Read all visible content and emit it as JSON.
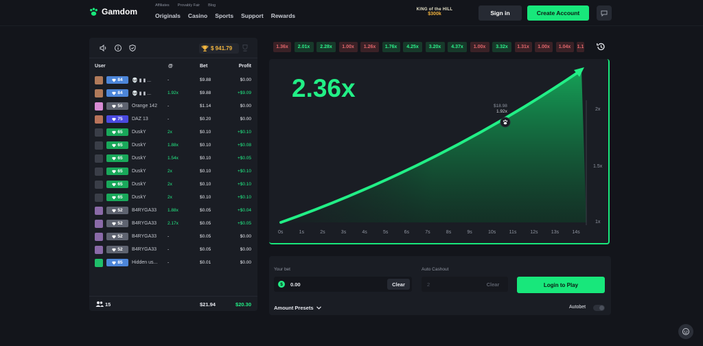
{
  "header": {
    "brand": "Gamdom",
    "small_links": [
      "Affiliates",
      "Provably Fair",
      "Blog"
    ],
    "main_links": [
      "Originals",
      "Casino",
      "Sports",
      "Support",
      "Rewards"
    ],
    "promo_title": "KING of the HILL",
    "promo_amount": "$300k",
    "sign_in": "Sign in",
    "create_account": "Create Account"
  },
  "left_panel": {
    "trophy_amount": "$ 941.79",
    "columns": {
      "user": "User",
      "mult": "@",
      "bet": "Bet",
      "profit": "Profit"
    },
    "rows": [
      {
        "avatar": "#b07a5a",
        "level": "84",
        "level_color": "#4d86d9",
        "name": "💀 ▮ ▮ ...",
        "mult": "-",
        "bet": "$9.88",
        "profit": "$0.00",
        "win": false
      },
      {
        "avatar": "#b07a5a",
        "level": "84",
        "level_color": "#4d86d9",
        "name": "💀 ▮ ▮ ...",
        "mult": "1.92x",
        "bet": "$9.88",
        "profit": "+$9.09",
        "win": true
      },
      {
        "avatar": "#d78bd3",
        "level": "56",
        "level_color": "#5e6370",
        "name": "Orange 142",
        "mult": "-",
        "bet": "$1.14",
        "profit": "$0.00",
        "win": false
      },
      {
        "avatar": "#b9735a",
        "level": "75",
        "level_color": "#4a4ae0",
        "name": "DAZ 13",
        "mult": "-",
        "bet": "$0.20",
        "profit": "$0.00",
        "win": false
      },
      {
        "avatar": "#3a3e48",
        "level": "65",
        "level_color": "#19a85a",
        "name": "DuskY",
        "mult": "2x",
        "bet": "$0.10",
        "profit": "+$0.10",
        "win": true
      },
      {
        "avatar": "#3a3e48",
        "level": "65",
        "level_color": "#19a85a",
        "name": "DuskY",
        "mult": "1.88x",
        "bet": "$0.10",
        "profit": "+$0.08",
        "win": true
      },
      {
        "avatar": "#3a3e48",
        "level": "65",
        "level_color": "#19a85a",
        "name": "DuskY",
        "mult": "1.54x",
        "bet": "$0.10",
        "profit": "+$0.05",
        "win": true
      },
      {
        "avatar": "#3a3e48",
        "level": "65",
        "level_color": "#19a85a",
        "name": "DuskY",
        "mult": "2x",
        "bet": "$0.10",
        "profit": "+$0.10",
        "win": true
      },
      {
        "avatar": "#3a3e48",
        "level": "65",
        "level_color": "#19a85a",
        "name": "DuskY",
        "mult": "2x",
        "bet": "$0.10",
        "profit": "+$0.10",
        "win": true
      },
      {
        "avatar": "#3a3e48",
        "level": "65",
        "level_color": "#19a85a",
        "name": "DuskY",
        "mult": "2x",
        "bet": "$0.10",
        "profit": "+$0.10",
        "win": true
      },
      {
        "avatar": "#8a6aa8",
        "level": "52",
        "level_color": "#5e6370",
        "name": "B4RYGA33",
        "mult": "1.88x",
        "bet": "$0.05",
        "profit": "+$0.04",
        "win": true
      },
      {
        "avatar": "#8a6aa8",
        "level": "52",
        "level_color": "#5e6370",
        "name": "B4RYGA33",
        "mult": "2.17x",
        "bet": "$0.05",
        "profit": "+$0.05",
        "win": true
      },
      {
        "avatar": "#8a6aa8",
        "level": "52",
        "level_color": "#5e6370",
        "name": "B4RYGA33",
        "mult": "-",
        "bet": "$0.05",
        "profit": "$0.00",
        "win": false
      },
      {
        "avatar": "#8a6aa8",
        "level": "52",
        "level_color": "#5e6370",
        "name": "B4RYGA33",
        "mult": "-",
        "bet": "$0.05",
        "profit": "$0.00",
        "win": false
      },
      {
        "avatar": "#1fbf6a",
        "level": "85",
        "level_color": "#4d86d9",
        "name": "Hidden us...",
        "mult": "-",
        "bet": "$0.01",
        "profit": "$0.00",
        "win": false
      }
    ],
    "footer": {
      "players": "15",
      "total_bet": "$21.94",
      "total_profit": "$20.30"
    }
  },
  "history": [
    {
      "v": "1.36x",
      "win": false
    },
    {
      "v": "2.01x",
      "win": true
    },
    {
      "v": "2.28x",
      "win": true
    },
    {
      "v": "1.00x",
      "win": false
    },
    {
      "v": "1.26x",
      "win": false
    },
    {
      "v": "1.76x",
      "win": true
    },
    {
      "v": "4.25x",
      "win": true
    },
    {
      "v": "3.20x",
      "win": true
    },
    {
      "v": "4.37x",
      "win": true
    },
    {
      "v": "1.00x",
      "win": false
    },
    {
      "v": "3.32x",
      "win": true
    },
    {
      "v": "1.31x",
      "win": false
    },
    {
      "v": "1.00x",
      "win": false
    },
    {
      "v": "1.04x",
      "win": false
    },
    {
      "v": "1.1",
      "win": false
    }
  ],
  "game": {
    "multiplier": "2.36x",
    "marker_amount": "$18.98",
    "marker_mult": "1.92x",
    "y_labels": [
      "2x",
      "1.5x",
      "1x"
    ],
    "x_labels": [
      "0s",
      "1s",
      "2s",
      "3s",
      "4s",
      "5s",
      "6s",
      "7s",
      "8s",
      "9s",
      "10s",
      "11s",
      "12s",
      "13s",
      "14s"
    ]
  },
  "bet_panel": {
    "your_bet_label": "Your bet",
    "bet_value": "0.00",
    "clear": "Clear",
    "auto_cashout_label": "Auto Cashout",
    "auto_cashout_value": "2",
    "clear2": "Clear",
    "login_to_play": "Login to Play",
    "amount_presets": "Amount Presets",
    "autobet": "Autobet"
  },
  "colors": {
    "accent": "#18e77b",
    "loss": "#e0666b",
    "gold": "#f3b63f"
  }
}
